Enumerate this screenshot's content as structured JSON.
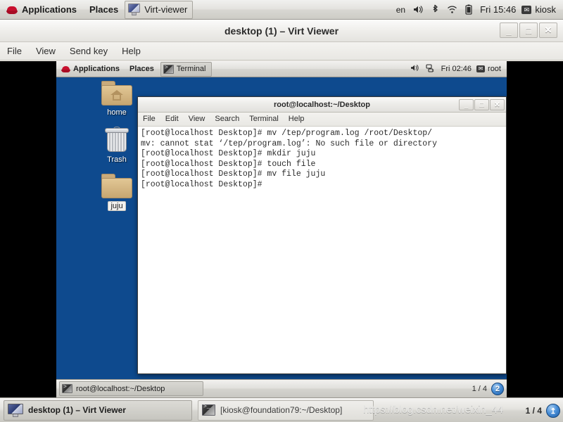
{
  "host_panel": {
    "logo_icon": "redhat-icon",
    "applications_label": "Applications",
    "places_label": "Places",
    "window_task_label": "Virt-viewer",
    "window_task_icon": "monitor-icon",
    "tray": {
      "language": "en",
      "volume_icon": "volume-icon",
      "bluetooth_icon": "bluetooth-icon",
      "wifi_icon": "wifi-icon",
      "battery_icon": "battery-icon",
      "clock": "Fri 15:46",
      "user_icon": "message-icon",
      "user": "kiosk"
    }
  },
  "virt_viewer": {
    "title": "desktop (1) – Virt Viewer",
    "buttons": {
      "minimize": "_",
      "maximize": "□",
      "close": "✕"
    },
    "menu": [
      "File",
      "View",
      "Send key",
      "Help"
    ]
  },
  "vm": {
    "panel": {
      "logo_icon": "redhat-icon",
      "applications_label": "Applications",
      "places_label": "Places",
      "task_label": "Terminal",
      "task_icon": "terminal-icon",
      "tray": {
        "volume_icon": "volume-icon",
        "network_icon": "network-disconnected-icon",
        "clock": "Fri 02:46",
        "user_icon": "message-icon",
        "user": "root"
      }
    },
    "desktop_icons": [
      {
        "name": "home",
        "icon": "home-folder-icon",
        "selected": false
      },
      {
        "name": "Trash",
        "icon": "trash-icon",
        "selected": false
      },
      {
        "name": "juju",
        "icon": "folder-icon",
        "selected": true
      }
    ],
    "terminal": {
      "title": "root@localhost:~/Desktop",
      "buttons": {
        "minimize": "_",
        "maximize": "□",
        "close": "✕"
      },
      "menu": [
        "File",
        "Edit",
        "View",
        "Search",
        "Terminal",
        "Help"
      ],
      "content": "[root@localhost Desktop]# mv /tep/program.log /root/Desktop/\nmv: cannot stat ‘/tep/program.log’: No such file or directory\n[root@localhost Desktop]# mkdir juju\n[root@localhost Desktop]# touch file\n[root@localhost Desktop]# mv file juju\n[root@localhost Desktop]# "
    },
    "taskbar": {
      "task_label": "root@localhost:~/Desktop",
      "task_icon": "terminal-icon",
      "workspace_label": "1 / 4",
      "badge": "2"
    }
  },
  "host_taskbar": {
    "task1_label": "desktop (1) – Virt Viewer",
    "task1_icon": "monitor-icon",
    "task2_label": "[kiosk@foundation79:~/Desktop]",
    "task2_icon": "terminal-icon",
    "watermark": "https://blog.csdn.net/weixin_44",
    "workspace_label": "1 / 4",
    "badge": "↥"
  },
  "colors": {
    "vm_desktop_blue": "#0e4a8e",
    "panel_grey": "#e2e1dd",
    "badge_blue": "#4a90d9",
    "terminal_bg": "#ffffff",
    "terminal_fg": "#2b2b2b"
  }
}
